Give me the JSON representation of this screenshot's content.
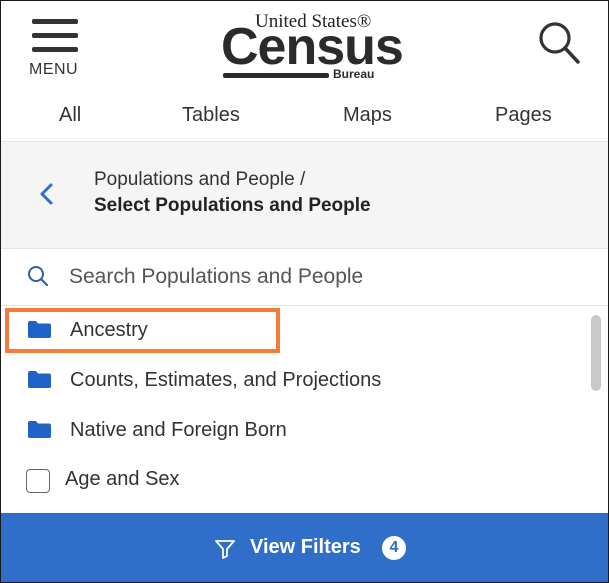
{
  "header": {
    "menu_label": "MENU",
    "logo": {
      "top": "United States®",
      "main": "Census",
      "sub": "Bureau"
    },
    "search_icon": "search-icon"
  },
  "tabs": [
    "All",
    "Tables",
    "Maps",
    "Pages"
  ],
  "breadcrumb": {
    "parent": "Populations and People /",
    "current": "Select Populations and People"
  },
  "filter_search": {
    "placeholder": "Search Populations and People"
  },
  "list": {
    "folders": [
      "Ancestry",
      "Counts, Estimates, and Projections",
      "Native and Foreign Born"
    ],
    "checkbox_item": "Age and Sex"
  },
  "footer": {
    "label": "View Filters",
    "count": "4"
  },
  "colors": {
    "accent": "#2f6fc9",
    "folder": "#1f63c6",
    "highlight": "#f47b3a"
  }
}
